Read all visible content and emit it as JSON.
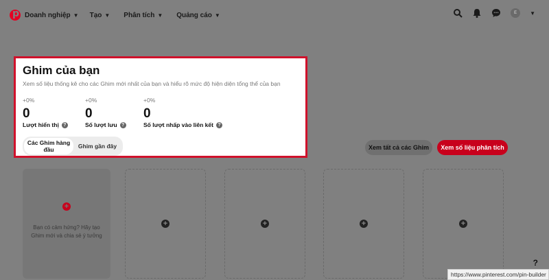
{
  "colors": {
    "accent": "#e60023",
    "highlight_border": "#d0112b",
    "overlay": "#808080"
  },
  "nav": {
    "items": [
      {
        "label": "Doanh nghiệp"
      },
      {
        "label": "Tạo"
      },
      {
        "label": "Phân tích"
      },
      {
        "label": "Quảng cáo"
      }
    ],
    "icons": [
      "search-icon",
      "bell-icon",
      "messages-icon",
      "avatar",
      "chevron-down-icon"
    ],
    "avatar_initial": "E"
  },
  "card": {
    "title": "Ghim của bạn",
    "subtitle": "Xem số liệu thống kê cho các Ghim mới nhất của bạn và hiểu rõ mức độ hiện diện tổng thể của bạn",
    "stats": [
      {
        "delta": "+0%",
        "value": "0",
        "label": "Lượt hiển thị"
      },
      {
        "delta": "+0%",
        "value": "0",
        "label": "Số lượt lưu"
      },
      {
        "delta": "+0%",
        "value": "0",
        "label": "Số lượt nhấp vào liên kết"
      }
    ],
    "toggle": {
      "active": "Các Ghim hàng đầu",
      "inactive": "Ghim gần đây"
    }
  },
  "actions": {
    "see_all": "Xem tất cả các Ghim",
    "see_stats": "Xem số liệu phân tích"
  },
  "pins": {
    "hint": "Bạn có cảm hứng? Hãy tạo Ghim mới và chia sẻ ý tưởng"
  },
  "status_url": "https://www.pinterest.com/pin-builder",
  "help_label": "?"
}
